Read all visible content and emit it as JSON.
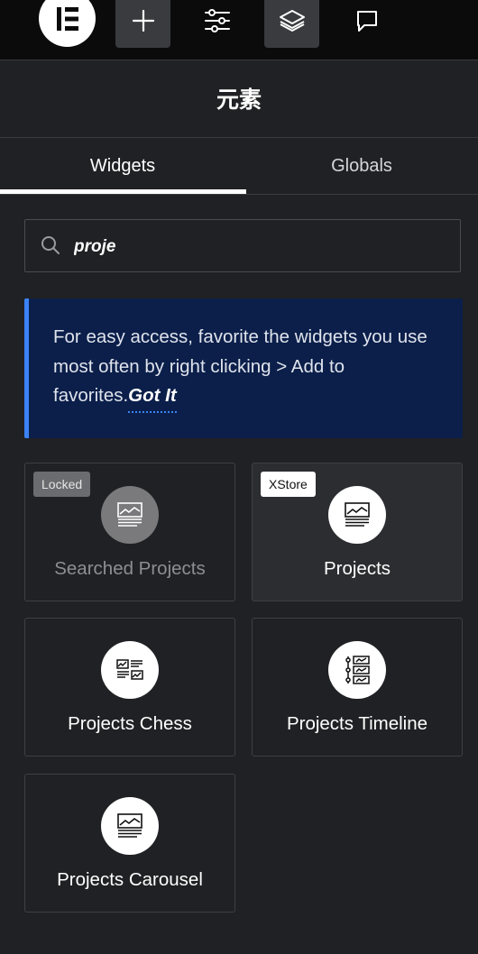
{
  "toolbar": {
    "logo_icon": "elementor-logo-icon",
    "items": [
      {
        "icon": "plus-icon",
        "active": true
      },
      {
        "icon": "sliders-icon",
        "active": false
      },
      {
        "icon": "layers-icon",
        "active": true
      },
      {
        "icon": "chat-icon",
        "active": false
      }
    ]
  },
  "panel": {
    "title": "元素"
  },
  "tabs": [
    {
      "label": "Widgets",
      "active": true
    },
    {
      "label": "Globals",
      "active": false
    }
  ],
  "search": {
    "value": "proje",
    "icon": "search-icon"
  },
  "notice": {
    "text": "For easy access, favorite the widgets you use most often by right clicking > Add to favorites.",
    "link": "Got It"
  },
  "widgets": [
    {
      "label": "Searched Projects",
      "badge": "Locked",
      "locked": true
    },
    {
      "label": "Projects",
      "badge": "XStore",
      "locked": false
    },
    {
      "label": "Projects Chess",
      "badge": "",
      "locked": false
    },
    {
      "label": "Projects Timeline",
      "badge": "",
      "locked": false
    },
    {
      "label": "Projects Carousel",
      "badge": "",
      "locked": false
    }
  ],
  "colors": {
    "accent": "#3b82f6",
    "notice_bg": "#0b1f4a",
    "panel_bg": "#202124"
  }
}
